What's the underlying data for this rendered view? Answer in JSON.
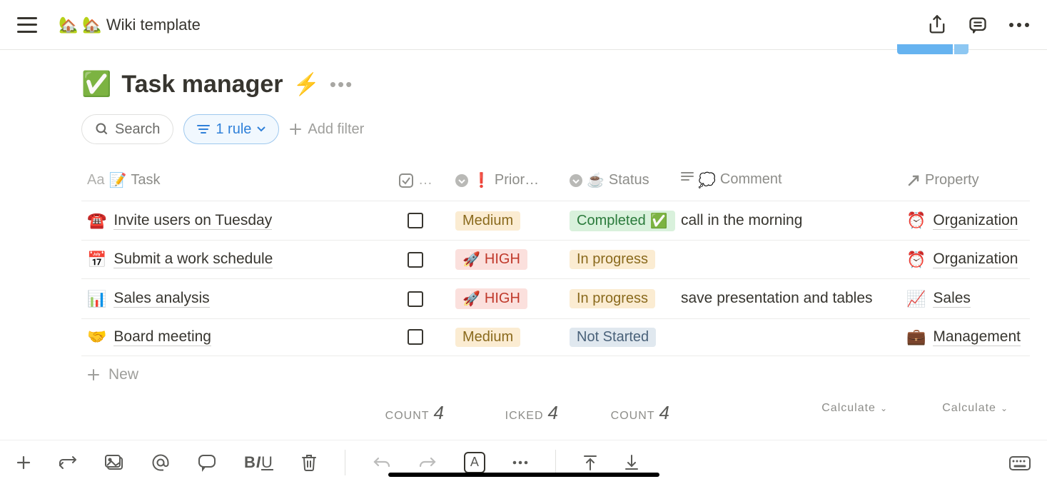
{
  "breadcrumb": {
    "icon1": "🏡",
    "icon2": "🏡",
    "label": "Wiki template"
  },
  "page_header": {
    "icon": "✅",
    "title": "Task manager",
    "bolt": "⚡"
  },
  "filters": {
    "search_label": "Search",
    "rule_label": "1 rule",
    "add_filter": "Add filter"
  },
  "columns": {
    "task": {
      "label": "Task",
      "prefix": "Aa",
      "emoji": "📝"
    },
    "check": {
      "label": "…"
    },
    "priority": {
      "label": "Prior…",
      "emoji": "❗"
    },
    "status": {
      "label": "Status",
      "emoji": "☕"
    },
    "comment": {
      "label": "Comment",
      "emoji": "💭"
    },
    "property": {
      "label": "Property"
    }
  },
  "rows": [
    {
      "icon": "☎️",
      "task": "Invite users on Tuesday",
      "checked": false,
      "priority": {
        "label": "Medium",
        "class": "medium",
        "emoji": ""
      },
      "status": {
        "label": "Completed",
        "class": "completed",
        "emoji_after": "✅"
      },
      "comment": "call in the morning",
      "property": {
        "emoji": "⏰",
        "label": "Organization"
      }
    },
    {
      "icon": "📅",
      "task": "Submit a work schedule",
      "checked": false,
      "priority": {
        "label": "HIGH",
        "class": "high",
        "emoji": "🚀"
      },
      "status": {
        "label": "In progress",
        "class": "in-progress",
        "emoji_after": ""
      },
      "comment": "",
      "property": {
        "emoji": "⏰",
        "label": "Organization"
      }
    },
    {
      "icon": "📊",
      "task": "Sales analysis",
      "checked": false,
      "priority": {
        "label": "HIGH",
        "class": "high",
        "emoji": "🚀"
      },
      "status": {
        "label": "In progress",
        "class": "in-progress",
        "emoji_after": ""
      },
      "comment": "save presentation and tables",
      "property": {
        "emoji": "📈",
        "label": "Sales"
      }
    },
    {
      "icon": "🤝",
      "task": "Board meeting",
      "checked": false,
      "priority": {
        "label": "Medium",
        "class": "medium",
        "emoji": ""
      },
      "status": {
        "label": "Not Started",
        "class": "not-started",
        "emoji_after": ""
      },
      "comment": "",
      "property": {
        "emoji": "💼",
        "label": "Management"
      }
    }
  ],
  "new_row_label": "New",
  "footer": {
    "count1_label": "COUNT",
    "count1_val": "4",
    "icked_label": "ICKED",
    "icked_val": "4",
    "count2_label": "COUNT",
    "count2_val": "4",
    "calc1": "Calculate",
    "calc2": "Calculate"
  }
}
